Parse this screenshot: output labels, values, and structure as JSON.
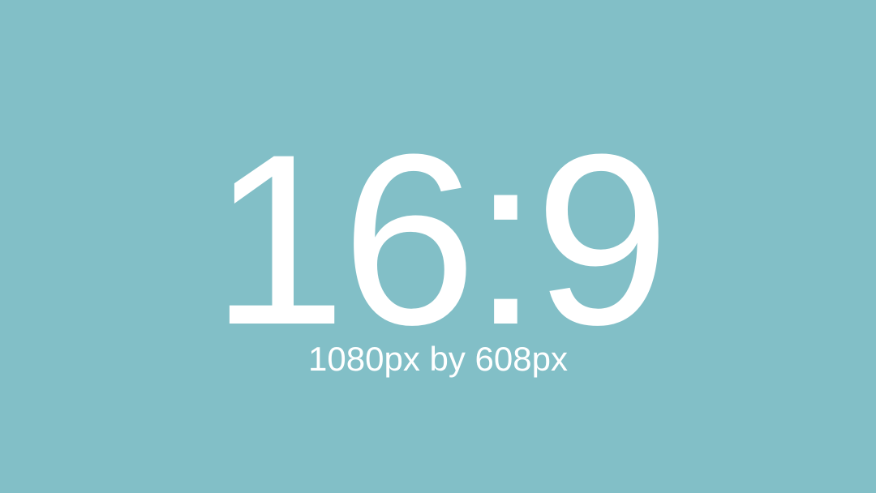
{
  "background_color": "#82bfc7",
  "text_color": "#ffffff",
  "aspect_ratio_label": "16:9",
  "dimensions_label": "1080px by 608px"
}
